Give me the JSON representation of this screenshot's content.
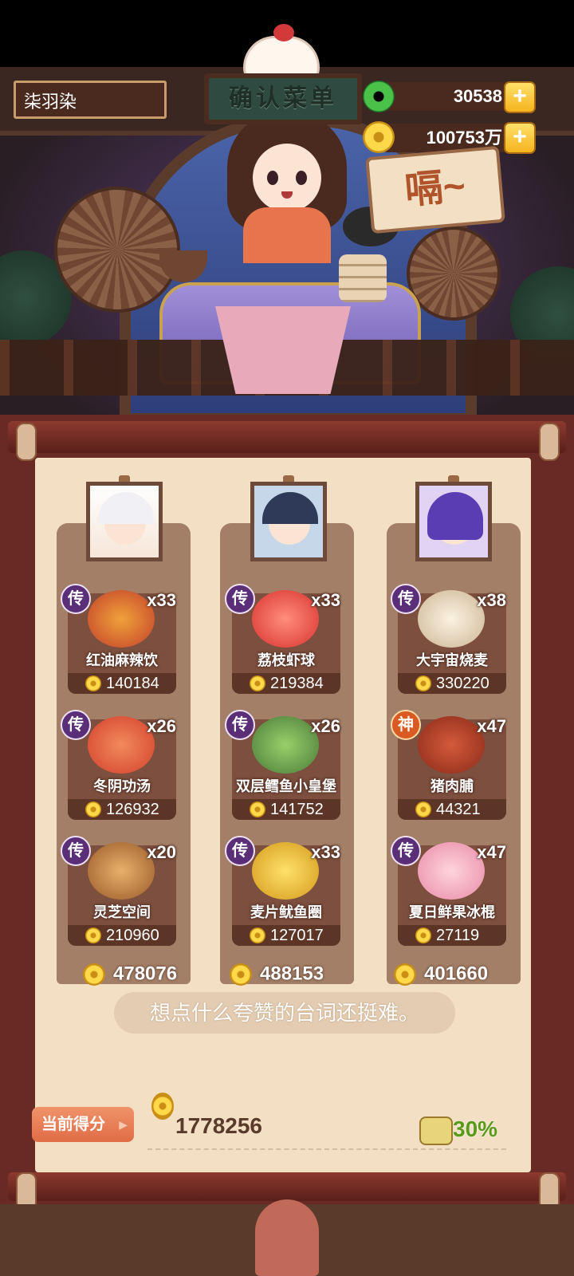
{
  "header": {
    "player_name": "柒羽染",
    "sign_title": "确认菜单",
    "jade_amount": "30538",
    "coin_amount": "100753万",
    "plus_label": "+",
    "speech_bubble": "嗝~"
  },
  "columns": [
    {
      "dishes": [
        {
          "tag": "传",
          "qty": "x33",
          "name": "红油麻辣饮",
          "price": "140184"
        },
        {
          "tag": "传",
          "qty": "x26",
          "name": "冬阴功汤",
          "price": "126932"
        },
        {
          "tag": "传",
          "qty": "x20",
          "name": "灵芝空间",
          "price": "210960"
        }
      ],
      "total": "478076"
    },
    {
      "dishes": [
        {
          "tag": "传",
          "qty": "x33",
          "name": "荔枝虾球",
          "price": "219384"
        },
        {
          "tag": "传",
          "qty": "x26",
          "name": "双层鳕鱼小皇堡",
          "price": "141752"
        },
        {
          "tag": "传",
          "qty": "x33",
          "name": "麦片鱿鱼圈",
          "price": "127017"
        }
      ],
      "total": "488153"
    },
    {
      "dishes": [
        {
          "tag": "传",
          "qty": "x38",
          "name": "大宇宙烧麦",
          "price": "330220"
        },
        {
          "tag": "神",
          "qty": "x47",
          "name": "猪肉脯",
          "price": "44321"
        },
        {
          "tag": "传",
          "qty": "x47",
          "name": "夏日鲜果冰棍",
          "price": "27119"
        }
      ],
      "total": "401660"
    }
  ],
  "quote": "想点什么夸赞的台词还挺难。",
  "score": {
    "label": "当前得分",
    "value": "1778256",
    "bonus": "30%"
  },
  "colors": {
    "tag_legend": "#5a2f78",
    "tag_god": "#d95a22",
    "bonus_green": "#5a9a1a",
    "frame": "#6a2a24"
  },
  "icons": [
    "jade-icon",
    "coin-icon",
    "plus-icon",
    "bonus-bag-icon",
    "arrow-right-icon"
  ]
}
